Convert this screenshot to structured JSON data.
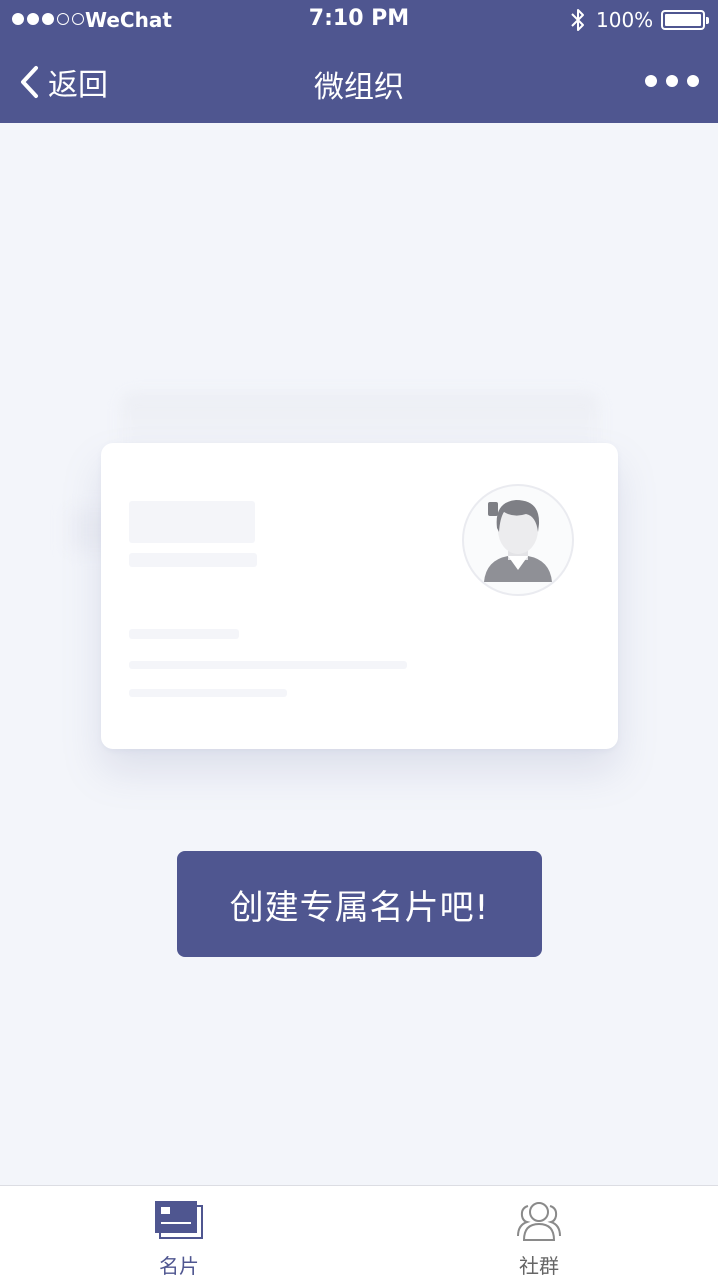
{
  "status_bar": {
    "carrier": "WeChat",
    "time": "7:10 PM",
    "battery": "100%",
    "signal_bars_filled": 3,
    "signal_bars_total": 5
  },
  "nav": {
    "back_label": "返回",
    "title": "微组织",
    "icons": {
      "back": "chevron-left-icon",
      "more": "more-dots-icon"
    }
  },
  "main": {
    "illustration_icon": "avatar-placeholder-icon",
    "cta_label": "创建专属名片吧!"
  },
  "tabbar": {
    "tabs": [
      {
        "label": "名片",
        "icon": "card-icon",
        "active": true
      },
      {
        "label": "社群",
        "icon": "group-icon",
        "active": false
      }
    ]
  },
  "colors": {
    "primary": "#4f5690",
    "background": "#f3f5fa",
    "tabbar_bg": "#ffffff"
  }
}
